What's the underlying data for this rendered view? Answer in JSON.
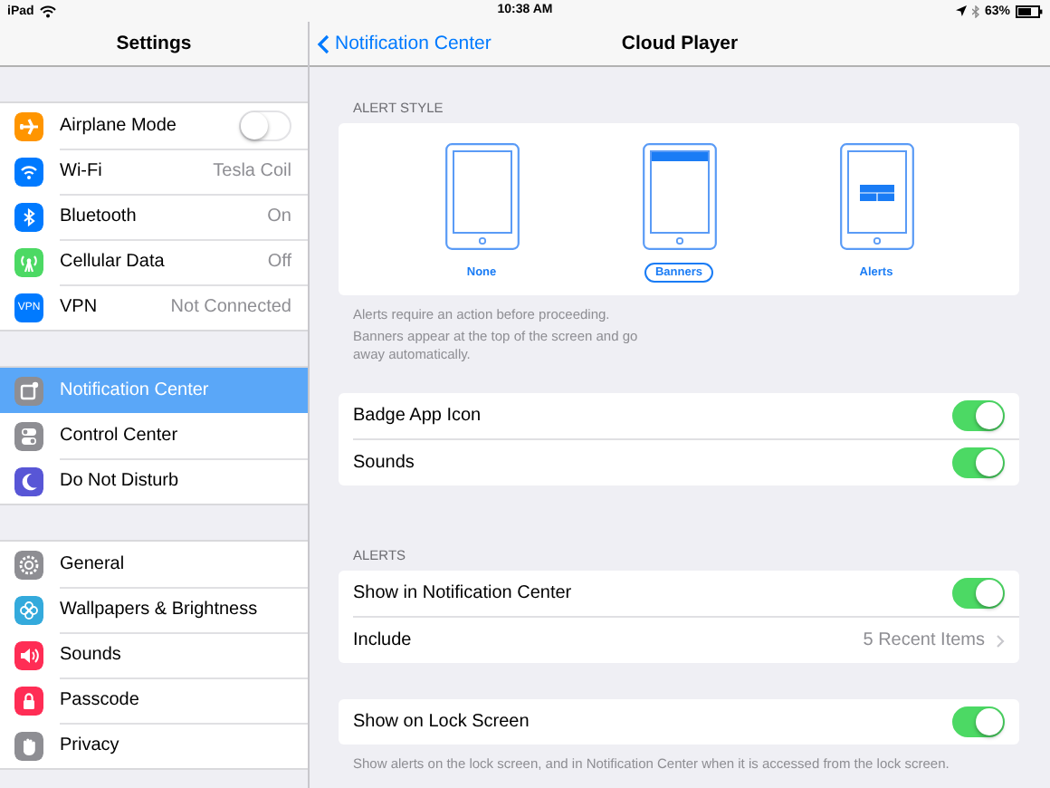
{
  "status_bar": {
    "device": "iPad",
    "time": "10:38 AM",
    "battery": "63%"
  },
  "sidebar": {
    "title": "Settings",
    "groups": [
      {
        "items": [
          {
            "label": "Airplane Mode",
            "kind": "toggle",
            "on": false,
            "selected": false
          },
          {
            "label": "Wi-Fi",
            "kind": "value",
            "value": "Tesla Coil",
            "selected": false
          },
          {
            "label": "Bluetooth",
            "kind": "value",
            "value": "On",
            "selected": false
          },
          {
            "label": "Cellular Data",
            "kind": "value",
            "value": "Off",
            "selected": false
          },
          {
            "label": "VPN",
            "kind": "value",
            "value": "Not Connected",
            "icon_text": "VPN",
            "selected": false
          }
        ]
      },
      {
        "items": [
          {
            "label": "Notification Center",
            "kind": "plain",
            "selected": true
          },
          {
            "label": "Control Center",
            "kind": "plain",
            "selected": false
          },
          {
            "label": "Do Not Disturb",
            "kind": "plain",
            "selected": false
          }
        ]
      },
      {
        "items": [
          {
            "label": "General",
            "kind": "plain",
            "selected": false
          },
          {
            "label": "Wallpapers & Brightness",
            "kind": "plain",
            "selected": false
          },
          {
            "label": "Sounds",
            "kind": "plain",
            "selected": false
          },
          {
            "label": "Passcode",
            "kind": "plain",
            "selected": false
          },
          {
            "label": "Privacy",
            "kind": "plain",
            "selected": false
          }
        ]
      }
    ]
  },
  "detail": {
    "back": "Notification Center",
    "title": "Cloud Player",
    "alert_style": {
      "header": "ALERT STYLE",
      "options": [
        {
          "label": "None",
          "kind": "none",
          "selected": false
        },
        {
          "label": "Banners",
          "kind": "banner",
          "selected": true
        },
        {
          "label": "Alerts",
          "kind": "alert",
          "selected": false
        }
      ],
      "footer": [
        "Alerts require an action before proceeding.",
        "Banners appear at the top of the screen and go away automatically."
      ]
    },
    "sections": [
      {
        "rows": [
          {
            "label": "Badge App Icon",
            "kind": "toggle",
            "on": true
          },
          {
            "label": "Sounds",
            "kind": "toggle",
            "on": true
          }
        ]
      },
      {
        "header": "ALERTS",
        "rows": [
          {
            "label": "Show in Notification Center",
            "kind": "toggle",
            "on": true
          },
          {
            "label": "Include",
            "kind": "link",
            "value": "5 Recent Items"
          }
        ]
      },
      {
        "rows": [
          {
            "label": "Show on Lock Screen",
            "kind": "toggle",
            "on": true
          }
        ],
        "footer": "Show alerts on the lock screen, and in Notification Center when it is accessed from the lock screen."
      }
    ]
  }
}
